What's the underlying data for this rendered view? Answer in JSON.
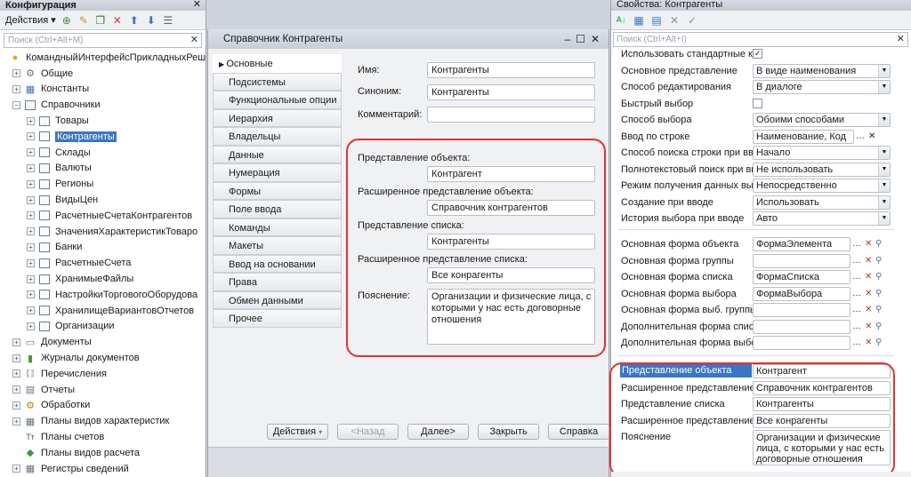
{
  "left": {
    "title": "Конфигурация",
    "toolbar_actions": "Действия",
    "search_placeholder": "Поиск (Ctrl+Alt+M)",
    "tree": [
      {
        "label": "КомандныйИнтерфейсПрикладныхРеш",
        "level": 0,
        "icon": "config-icon"
      },
      {
        "label": "Общие",
        "level": 1,
        "icon": "common-icon",
        "exp": "+"
      },
      {
        "label": "Константы",
        "level": 1,
        "icon": "constants-icon",
        "exp": "+"
      },
      {
        "label": "Справочники",
        "level": 1,
        "icon": "catalog-icon",
        "exp": "-"
      },
      {
        "label": "Товары",
        "level": 2,
        "icon": "catalog-icon",
        "exp": "+"
      },
      {
        "label": "Контрагенты",
        "level": 2,
        "icon": "catalog-icon",
        "exp": "+",
        "selected": true
      },
      {
        "label": "Склады",
        "level": 2,
        "icon": "catalog-icon",
        "exp": "+"
      },
      {
        "label": "Валюты",
        "level": 2,
        "icon": "catalog-icon",
        "exp": "+"
      },
      {
        "label": "Регионы",
        "level": 2,
        "icon": "catalog-icon",
        "exp": "+"
      },
      {
        "label": "ВидыЦен",
        "level": 2,
        "icon": "catalog-icon",
        "exp": "+"
      },
      {
        "label": "РасчетныеСчетаКонтрагентов",
        "level": 2,
        "icon": "catalog-icon",
        "exp": "+"
      },
      {
        "label": "ЗначенияХарактеристикТоваро",
        "level": 2,
        "icon": "catalog-icon",
        "exp": "+"
      },
      {
        "label": "Банки",
        "level": 2,
        "icon": "catalog-icon",
        "exp": "+"
      },
      {
        "label": "РасчетныеСчета",
        "level": 2,
        "icon": "catalog-icon",
        "exp": "+"
      },
      {
        "label": "ХранимыеФайлы",
        "level": 2,
        "icon": "catalog-icon",
        "exp": "+"
      },
      {
        "label": "НастройкиТорговогоОборудова",
        "level": 2,
        "icon": "catalog-icon",
        "exp": "+"
      },
      {
        "label": "ХранилищеВариантовОтчетов",
        "level": 2,
        "icon": "catalog-icon",
        "exp": "+"
      },
      {
        "label": "Организации",
        "level": 2,
        "icon": "catalog-icon",
        "exp": "+"
      },
      {
        "label": "Документы",
        "level": 1,
        "icon": "document-icon",
        "exp": "+"
      },
      {
        "label": "Журналы документов",
        "level": 1,
        "icon": "journal-icon",
        "exp": "+"
      },
      {
        "label": "Перечисления",
        "level": 1,
        "icon": "enum-icon",
        "exp": "+"
      },
      {
        "label": "Отчеты",
        "level": 1,
        "icon": "report-icon",
        "exp": "+"
      },
      {
        "label": "Обработки",
        "level": 1,
        "icon": "processing-icon",
        "exp": "+"
      },
      {
        "label": "Планы видов характеристик",
        "level": 1,
        "icon": "chart-of-characteristics-icon",
        "exp": "+"
      },
      {
        "label": "Планы счетов",
        "level": 1,
        "icon": "chart-of-accounts-icon",
        "exp": ""
      },
      {
        "label": "Планы видов расчета",
        "level": 1,
        "icon": "calculation-types-icon",
        "exp": ""
      },
      {
        "label": "Регистры сведений",
        "level": 1,
        "icon": "register-icon",
        "exp": "+"
      }
    ]
  },
  "middle": {
    "title": "Справочник Контрагенты",
    "nav": [
      "Основные",
      "Подсистемы",
      "Функциональные опции",
      "Иерархия",
      "Владельцы",
      "Данные",
      "Нумерация",
      "Формы",
      "Поле ввода",
      "Команды",
      "Макеты",
      "Ввод на основании",
      "Права",
      "Обмен данными",
      "Прочее"
    ],
    "form": {
      "name_label": "Имя:",
      "name_value": "Контрагенты",
      "synonym_label": "Синоним:",
      "synonym_value": "Контрагенты",
      "comment_label": "Комментарий:",
      "comment_value": "",
      "obj_repr_label": "Представление объекта:",
      "obj_repr_value": "Контрагент",
      "ext_obj_repr_label": "Расширенное представление объекта:",
      "ext_obj_repr_value": "Справочник контрагентов",
      "list_repr_label": "Представление списка:",
      "list_repr_value": "Контрагенты",
      "ext_list_repr_label": "Расширенное представление списка:",
      "ext_list_repr_value": "Все конрагенты",
      "explanation_label": "Пояснение:",
      "explanation_value": "Организации и физические лица, с которыми у нас есть договорные отношения"
    },
    "buttons": {
      "actions": "Действия",
      "back": "<Назад",
      "next": "Далее>",
      "close": "Закрыть",
      "help": "Справка"
    }
  },
  "right": {
    "title": "Свойства: Контрагенты",
    "search_placeholder": "Поиск (Ctrl+Alt+I)",
    "rows": [
      {
        "label": "Использовать стандартные ко",
        "type": "check",
        "value": "✓"
      },
      {
        "label": "Основное представление",
        "type": "dd",
        "value": "В виде наименования"
      },
      {
        "label": "Способ редактирования",
        "type": "dd",
        "value": "В диалоге"
      },
      {
        "label": "Быстрый выбор",
        "type": "check",
        "value": ""
      },
      {
        "label": "Способ выбора",
        "type": "dd",
        "value": "Обоими способами"
      },
      {
        "label": "Ввод по строке",
        "type": "dots-x",
        "value": "Наименование, Код"
      },
      {
        "label": "Способ поиска строки при вво",
        "type": "dd",
        "value": "Начало"
      },
      {
        "label": "Полнотекстовый поиск при вв",
        "type": "dd",
        "value": "Не использовать"
      },
      {
        "label": "Режим получения данных выбо",
        "type": "dd",
        "value": "Непосредственно"
      },
      {
        "label": "Создание при вводе",
        "type": "dd",
        "value": "Использовать"
      },
      {
        "label": "История выбора при вводе",
        "type": "dd",
        "value": "Авто"
      },
      {
        "label": "Основная форма объекта",
        "type": "form",
        "value": "ФормаЭлемента"
      },
      {
        "label": "Основная форма группы",
        "type": "form",
        "value": ""
      },
      {
        "label": "Основная форма списка",
        "type": "form",
        "value": "ФормаСписка"
      },
      {
        "label": "Основная форма выбора",
        "type": "form",
        "value": "ФормаВыбора"
      },
      {
        "label": "Основная форма выб. группы",
        "type": "form",
        "value": ""
      },
      {
        "label": "Дополнительная форма списк",
        "type": "form",
        "value": ""
      },
      {
        "label": "Дополнительная форма выбор",
        "type": "form",
        "value": ""
      },
      {
        "label": "Представление объекта",
        "type": "text",
        "value": "Контрагент",
        "highlight": true
      },
      {
        "label": "Расширенное представление о",
        "type": "text",
        "value": "Справочник контрагентов"
      },
      {
        "label": "Представление списка",
        "type": "text",
        "value": "Контрагенты"
      },
      {
        "label": "Расширенное представление с",
        "type": "text",
        "value": "Все конрагенты"
      },
      {
        "label": "Пояснение",
        "type": "area",
        "value": "Организации и физические лица, с которыми у нас есть договорные отношения"
      }
    ]
  },
  "colors": {
    "highlight_red": "#e2322e",
    "selection_blue": "#3b76c4"
  }
}
